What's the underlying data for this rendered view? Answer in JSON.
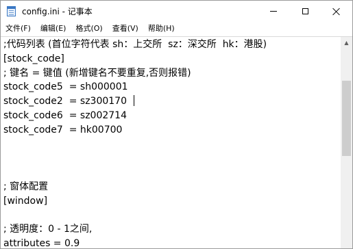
{
  "window": {
    "title": "config.ini - 记事本"
  },
  "icons": {
    "app": "notepad-icon",
    "minimize": "minimize-icon",
    "maximize": "maximize-icon",
    "close": "close-icon",
    "scroll_up": "chevron-up-icon"
  },
  "menu": [
    {
      "label": "文件(F)"
    },
    {
      "label": "编辑(E)"
    },
    {
      "label": "格式(O)"
    },
    {
      "label": "查看(V)"
    },
    {
      "label": "帮助(H)"
    }
  ],
  "editor": {
    "lines": [
      ";代码列表 (首位字符代表 sh：上交所  sz：深交所  hk：港股)",
      "[stock_code]",
      "; 键名 = 键值 (新增键名不要重复,否则报错)",
      "stock_code5  = sh000001",
      "stock_code2  = sz300170",
      "stock_code6  = sz002714",
      "stock_code7  = hk00700",
      "",
      "",
      "",
      "; 窗体配置",
      "[window]",
      "",
      "; 透明度：0 - 1之间,",
      "attributes = 0.9"
    ]
  },
  "colors": {
    "scroll_thumb": "#cdcdcd",
    "scroll_track": "#f0f0f0"
  }
}
